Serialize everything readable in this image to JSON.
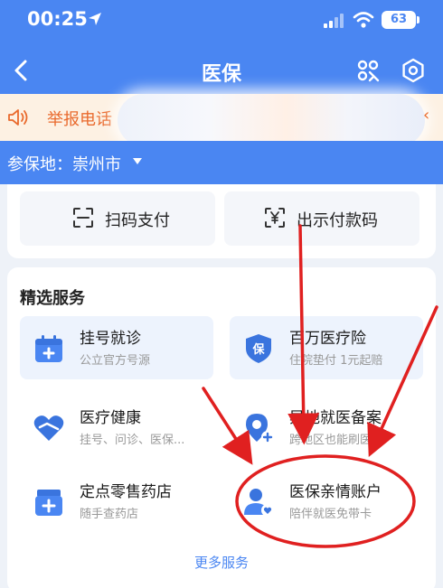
{
  "status_bar": {
    "time": "00:25",
    "battery": "63"
  },
  "nav": {
    "title": "医保"
  },
  "notice": {
    "label": "举报电话"
  },
  "region": {
    "label": "参保地：崇州市"
  },
  "pay": {
    "scan_label": "扫码支付",
    "show_code_label": "出示付款码"
  },
  "services": {
    "title": "精选服务",
    "items": [
      {
        "title": "挂号就诊",
        "subtitle": "公立官方号源",
        "icon": "calendar-plus-icon"
      },
      {
        "title": "百万医疗险",
        "subtitle": "住院垫付 1元起赔",
        "icon": "shield-bao-icon"
      },
      {
        "title": "医疗健康",
        "subtitle": "挂号、问诊、医保...",
        "icon": "heart-icon"
      },
      {
        "title": "异地就医备案",
        "subtitle": "跨地区也能刷医保",
        "icon": "location-plus-icon"
      },
      {
        "title": "定点零售药店",
        "subtitle": "随手查药店",
        "icon": "medicine-box-icon"
      },
      {
        "title": "医保亲情账户",
        "subtitle": "陪伴就医免带卡",
        "icon": "family-user-icon"
      }
    ],
    "more_label": "更多服务"
  },
  "colors": {
    "brand_blue": "#4a86f2",
    "notice_orange": "#e96a2d",
    "annotation_red": "#e02020"
  }
}
